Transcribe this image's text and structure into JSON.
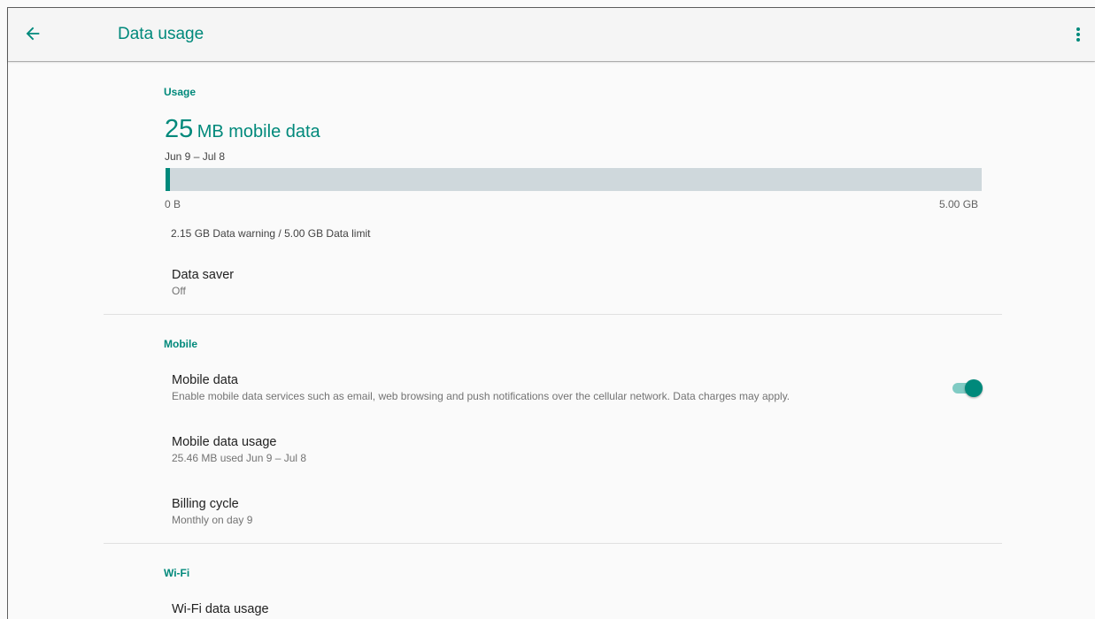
{
  "app_bar": {
    "title": "Data usage",
    "back_icon": "arrow-back-icon",
    "more_icon": "more-vert-icon"
  },
  "usage": {
    "header": "Usage",
    "amount": "25",
    "amount_unit": "MB mobile data",
    "period": "Jun 9 – Jul 8",
    "bar_min_label": "0 B",
    "bar_max_label": "5.00 GB",
    "bar_fill_fraction": 0.005,
    "limits_text": "2.15 GB Data warning / 5.00 GB Data limit"
  },
  "data_saver": {
    "title": "Data saver",
    "status": "Off"
  },
  "mobile": {
    "header": "Mobile",
    "mobile_data": {
      "title": "Mobile data",
      "description": "Enable mobile data services such as email, web browsing and push notifications over the cellular network. Data charges may apply.",
      "enabled": true
    },
    "mobile_data_usage": {
      "title": "Mobile data usage",
      "summary": "25.46 MB used Jun 9 – Jul 8"
    },
    "billing_cycle": {
      "title": "Billing cycle",
      "summary": "Monthly on day 9"
    }
  },
  "wifi": {
    "header": "Wi-Fi",
    "wifi_data_usage": {
      "title": "Wi-Fi data usage"
    }
  },
  "colors": {
    "accent": "#00897b",
    "accent_light": "#80cbc4",
    "bar_track": "#cfd8dc"
  }
}
